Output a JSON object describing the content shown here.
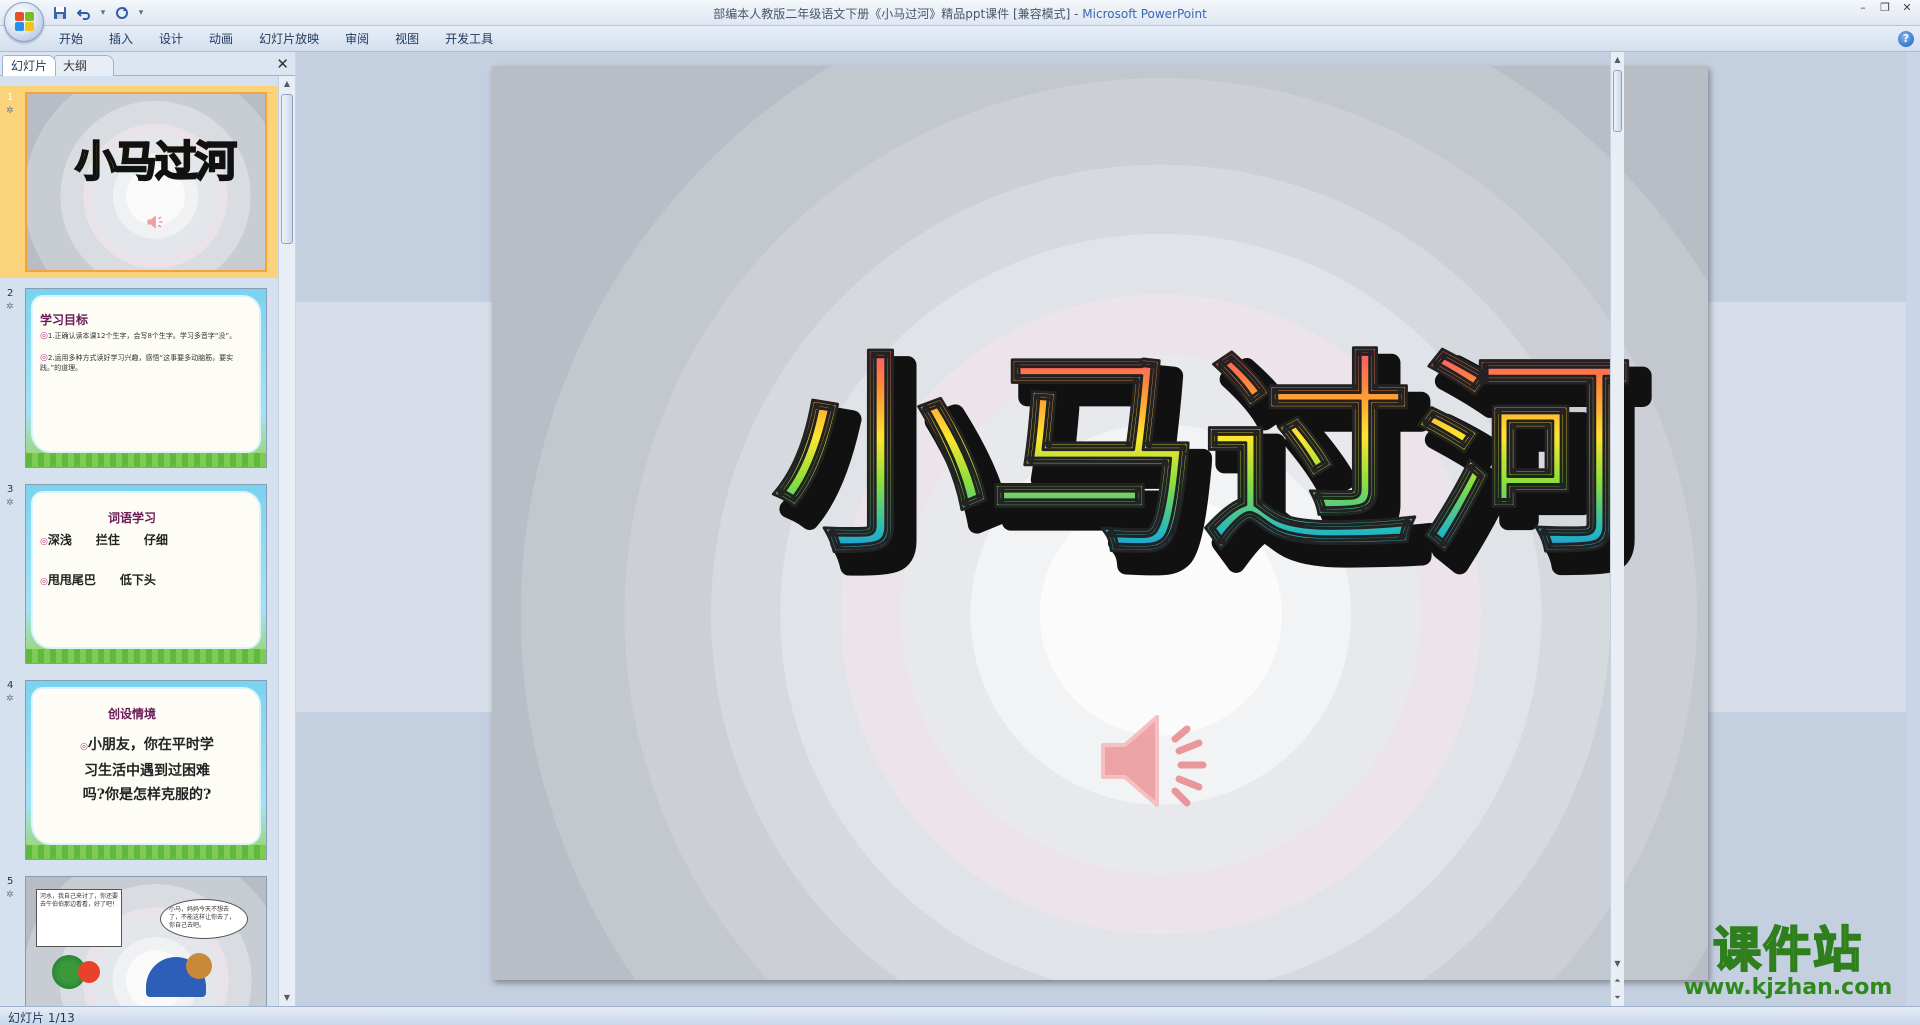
{
  "window": {
    "title": "部编本人教版二年级语文下册《小马过河》精品ppt课件 [兼容模式]",
    "title_sep": " - ",
    "app_name": "Microsoft PowerPoint"
  },
  "ribbon": {
    "tabs": [
      "开始",
      "插入",
      "设计",
      "动画",
      "幻灯片放映",
      "审阅",
      "视图",
      "开发工具"
    ]
  },
  "panel": {
    "tabs": [
      "幻灯片",
      "大纲"
    ],
    "close_glyph": "✕"
  },
  "thumbnails": [
    {
      "number": "1",
      "title": "小马过河"
    },
    {
      "number": "2",
      "title": "学习目标",
      "lines": [
        "1.正确认读本课12个生字，会写8个生字。学习多音字“没”。",
        "2.运用多种方式读好学习兴趣，感悟“这事要多动脑筋，要实践。”的道理。"
      ]
    },
    {
      "number": "3",
      "title": "词语学习",
      "lines": [
        "深浅　　拦住　　仔细",
        "甩甩尾巴　　低下头"
      ]
    },
    {
      "number": "4",
      "title": "创设情境",
      "body_lines": [
        "小朋友，你在平时学",
        "习生活中遇到过困难",
        "吗?你是怎样克服的?"
      ]
    },
    {
      "number": "5",
      "bubble_left": "河水，我自己来讨了，你还要去牛伯伯那边看看，好了吧！",
      "bubble_right": "小马，妈妈今天不想去了，不能这样让你去了，你自己去吧。"
    }
  ],
  "slide": {
    "title": "小马过河"
  },
  "watermark": {
    "main": "课件站",
    "url": "www.kjzhan.com"
  },
  "status": {
    "slide_indicator": "幻灯片 1/13"
  },
  "colors": {
    "title_gradient": [
      "#ff3a86",
      "#ff8a3a",
      "#ffe62e",
      "#8be03c",
      "#23b8c2",
      "#2c62e6"
    ],
    "speaker": "#e8888c",
    "selection": "#fbd37a",
    "accent_purple": "#6a1a57"
  },
  "icons": [
    "office-button-icon",
    "save-icon",
    "undo-icon",
    "redo-icon",
    "qat-dropdown-icon",
    "help-icon",
    "speaker-icon"
  ]
}
